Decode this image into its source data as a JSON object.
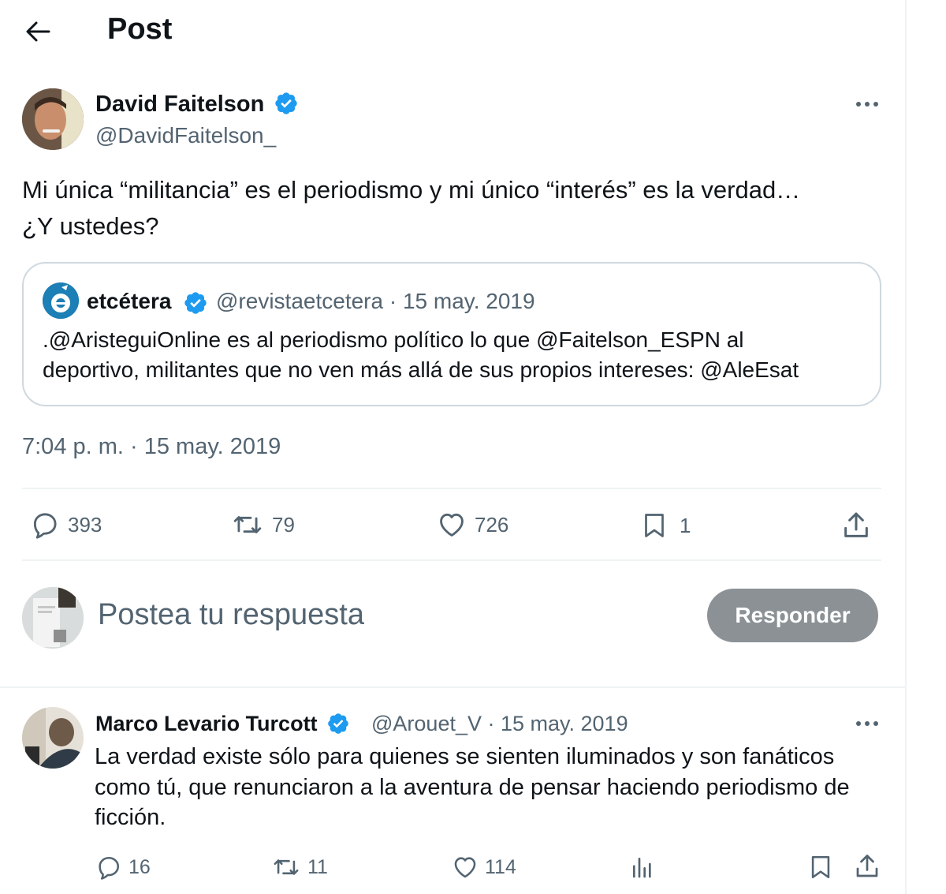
{
  "header": {
    "title": "Post"
  },
  "post": {
    "author": {
      "name": "David Faitelson",
      "handle": "@DavidFaitelson_"
    },
    "text_line1": "Mi única “militancia” es el periodismo y mi único “interés” es la verdad…",
    "text_line2": "¿Y ustedes?",
    "quote": {
      "name": "etcétera",
      "meta": "@revistaetcetera · 15 may. 2019",
      "text_line1": ".@AristeguiOnline es al periodismo político lo que @Faitelson_ESPN al",
      "text_line2": "deportivo, militantes que no ven más allá de sus propios intereses: @AleEsat"
    },
    "timestamp": "7:04 p. m. · 15 may. 2019",
    "stats": {
      "replies": "393",
      "reposts": "79",
      "likes": "726",
      "bookmarks": "1"
    }
  },
  "composer": {
    "placeholder": "Postea tu respuesta",
    "button_label": "Responder"
  },
  "reply": {
    "author": {
      "name": "Marco Levario Turcott",
      "meta": "@Arouet_V · 15 may. 2019"
    },
    "text_line1": "La verdad existe sólo para quienes se sienten iluminados y son fanáticos",
    "text_line2": "como tú, que renunciaron a la aventura de pensar haciendo periodismo de",
    "text_line3": "ficción.",
    "stats": {
      "replies": "16",
      "reposts": "11",
      "likes": "114"
    }
  },
  "colors": {
    "verified": "#1d9bf0",
    "secondary_text": "#536471",
    "disabled_button": "#8b9195",
    "border": "#cfd9de"
  },
  "icons": [
    "back-arrow-icon",
    "verified-badge-icon",
    "more-icon",
    "reply-icon",
    "repost-icon",
    "like-icon",
    "bookmark-icon",
    "share-icon",
    "analytics-icon"
  ]
}
